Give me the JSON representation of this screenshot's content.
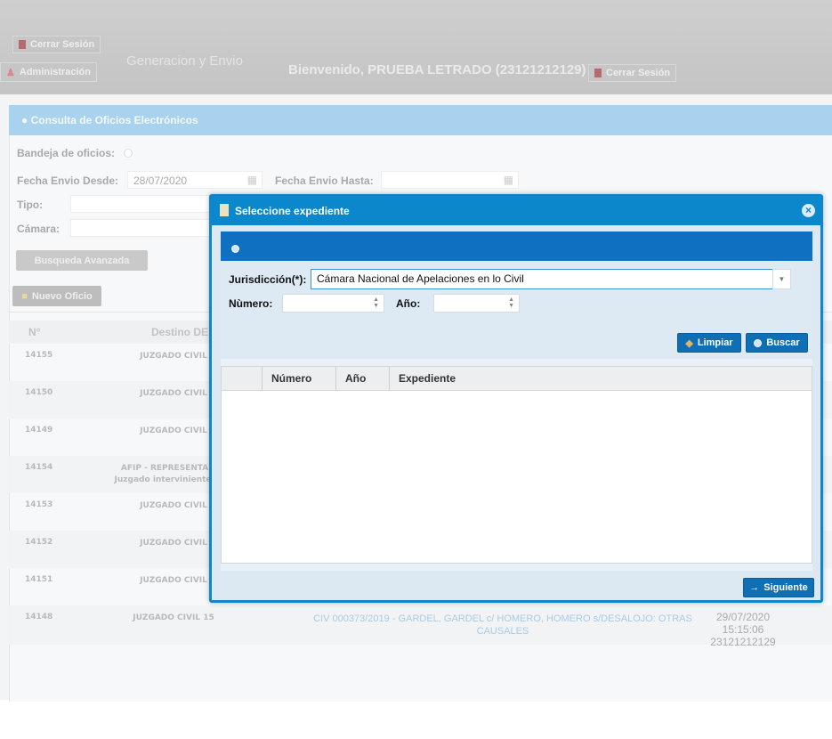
{
  "header": {
    "cerrar_top": "Cerrar Sesión",
    "administracion": "Administración",
    "generacion": "Generacion y Envio",
    "welcome": "Bienvenido, PRUEBA LETRADO (23121212129)",
    "cerrar": "Cerrar Sesión"
  },
  "panel": {
    "title": "Consulta de Oficios Electrónicos",
    "bandeja_label": "Bandeja de oficios:",
    "fecha_desde_label": "Fecha Envio Desde:",
    "fecha_desde_value": "28/07/2020",
    "fecha_hasta_label": "Fecha Envio Hasta:",
    "tipo_label": "Tipo:",
    "camara_label": "Cámara:",
    "busqueda_avanzada": "Busqueda Avanzada",
    "nuevo_oficio": "Nuevo Oficio"
  },
  "table": {
    "headers": [
      "N°",
      "Destino DE"
    ],
    "rows": [
      {
        "n": "14155",
        "destino": "JUZGADO CIVIL",
        "destino2": ""
      },
      {
        "n": "14150",
        "destino": "JUZGADO CIVIL",
        "destino2": ""
      },
      {
        "n": "14149",
        "destino": "JUZGADO CIVIL",
        "destino2": ""
      },
      {
        "n": "14154",
        "destino": "AFIP - REPRESENTANTE",
        "destino2": "Juzgado interviniente: JUZ"
      },
      {
        "n": "14153",
        "destino": "JUZGADO CIVIL",
        "destino2": ""
      },
      {
        "n": "14152",
        "destino": "JUZGADO CIVIL",
        "destino2": ""
      },
      {
        "n": "14151",
        "destino": "JUZGADO CIVIL",
        "destino2": ""
      },
      {
        "n": "14148",
        "destino": "JUZGADO CIVIL 15",
        "destino2": ""
      }
    ],
    "last_row": {
      "expediente": "CIV 000373/2019 - GARDEL, GARDEL c/ HOMERO, HOMERO s/DESALOJO: OTRAS CAUSALES",
      "fecha": "29/07/2020 15:15:06",
      "usuario": "23121212129"
    }
  },
  "dialog": {
    "title": "Seleccione expediente",
    "jurisdiccion_label": "Jurisdicción(*):",
    "jurisdiccion_value": "Cámara Nacional de Apelaciones en lo Civil",
    "numero_label": "Nùmero:",
    "anio_label": "Año:",
    "limpiar": "Limpiar",
    "buscar": "Buscar",
    "grid_headers": [
      "Número",
      "Año",
      "Expediente"
    ],
    "siguiente": "Siguiente"
  },
  "colors": {
    "dialog_blue": "#0b87cc",
    "button_blue": "#0f6fb5",
    "panel_header": "#a8d2ee"
  }
}
